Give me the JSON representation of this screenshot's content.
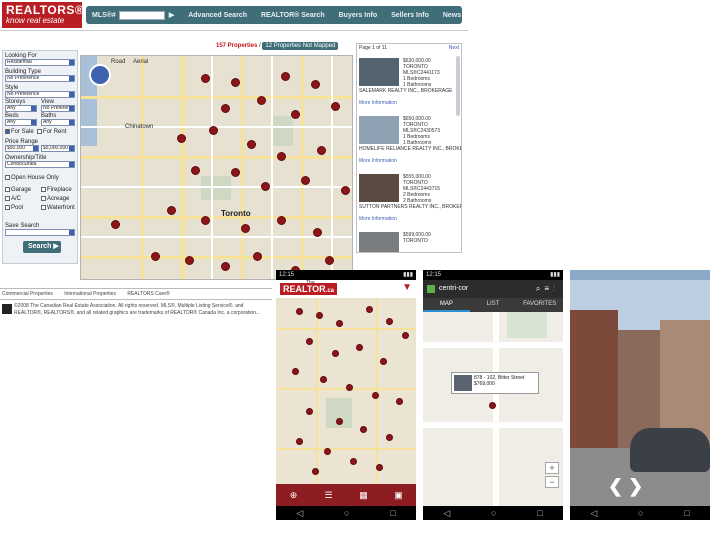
{
  "site": {
    "logo_line1": "REALTORS®",
    "logo_line2": "know real estate",
    "nav": {
      "mls_label": "MLS®#",
      "links": [
        "Advanced Search",
        "REALTOR® Search",
        "Buyers Info",
        "Sellers Info",
        "News"
      ]
    },
    "filters": {
      "looking_for": {
        "label": "Looking For",
        "value": "Residential"
      },
      "building_type": {
        "label": "Building Type",
        "value": "No Preference"
      },
      "style": {
        "label": "Style",
        "value": "No Preference"
      },
      "storeys": {
        "label": "Storeys",
        "value": "Any"
      },
      "view": {
        "label": "View",
        "value": "No Preferen"
      },
      "beds": {
        "label": "Beds",
        "value": "Any"
      },
      "baths": {
        "label": "Baths",
        "value": "Any"
      },
      "for_sale": "For Sale",
      "for_rent": "For Rent",
      "price_range": {
        "label": "Price Range",
        "min": "$50,000",
        "max": "$5,000,000"
      },
      "ownership": {
        "label": "Ownership/Title",
        "value": "Condo/Strata"
      },
      "open_house": "Open House Only",
      "amenities": [
        "Garage",
        "Fireplace",
        "A/C",
        "Acreage",
        "Pool",
        "Waterfront"
      ],
      "save_search": "Save Search",
      "search_btn": "Search"
    },
    "tabs": {
      "properties": "157 Properties",
      "not_mapped": "12 Properties Not Mapped"
    },
    "map": {
      "tab_road": "Road",
      "tab_aerial": "Aerial",
      "city_label": "Toronto",
      "area_label": "Chinatown"
    },
    "results": {
      "header": "Page 1 of 11",
      "next": "Next",
      "listings": [
        {
          "price": "$630,000.00",
          "city": "TORONTO",
          "mls": "MLS®C2441173",
          "beds": "1 Bedrooms",
          "baths": "1 Bathrooms",
          "brokerage": "SALEMARK REALTY INC., BROKERAGE",
          "more": "More Information"
        },
        {
          "price": "$650,000.00",
          "city": "TORONTO",
          "mls": "MLS®C2430573",
          "beds": "1 Bedrooms",
          "baths": "1 Bathrooms",
          "brokerage": "HOMELIFE RELIANCE REALTY INC., BROKERAGE",
          "more": "More Information"
        },
        {
          "price": "$555,000.00",
          "city": "TORONTO",
          "mls": "MLS®C2443715",
          "beds": "2 Bedrooms",
          "baths": "2 Bathrooms",
          "brokerage": "SUTTON PARTNERS REALTY INC., BROKERAGE",
          "more": "More Information"
        },
        {
          "price": "$599,000.00",
          "city": "TORONTO",
          "mls": "",
          "beds": "",
          "baths": "",
          "brokerage": "",
          "more": ""
        }
      ]
    },
    "footer": {
      "links": [
        "Commercial Properties",
        "International Properties",
        "REALTORS Care®"
      ],
      "copyright": "©2008 The Canadian Real Estate Association. All rights reserved. MLS®, Multiple Listing Service®, and REALTOR®, REALTORS®, and all related graphics are trademarks of REALTOR® Canada Inc. a corporation..."
    }
  },
  "phones": {
    "statusbar_time": "12:15",
    "p1": {
      "logo": "REALTOR",
      "logo_suffix": ".ca",
      "logo_top": "The"
    },
    "p2": {
      "app_title": "centri-cor",
      "tabs": [
        "MAP",
        "LIST",
        "FAVORITES"
      ],
      "popup_line1": "878 - 102, Bitter Street",
      "popup_line2": "$769,000"
    }
  },
  "colors": {
    "brand_red": "#b81e24",
    "nav_teal": "#3f6e78",
    "pin": "#8d1418"
  }
}
